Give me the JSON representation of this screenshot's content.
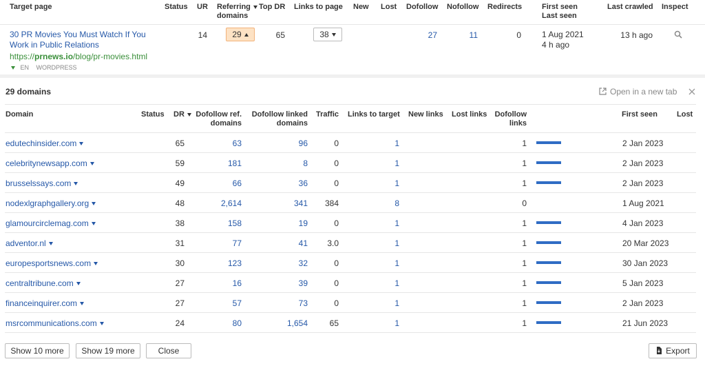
{
  "top": {
    "headers": {
      "target_page": "Target page",
      "status": "Status",
      "ur": "UR",
      "referring_l1": "Referring",
      "referring_l2": "domains",
      "top_dr": "Top DR",
      "links_to_page": "Links to page",
      "new": "New",
      "lost": "Lost",
      "dofollow": "Dofollow",
      "nofollow": "Nofollow",
      "redirects": "Redirects",
      "first_seen": "First seen",
      "last_seen": "Last seen",
      "last_crawled": "Last crawled",
      "inspect": "Inspect"
    },
    "row": {
      "title_l1": "30 PR Movies You Must Watch If You",
      "title_l2": "Work in Public Relations",
      "url_prefix": "https://",
      "url_domain": "prnews.io",
      "url_path": "/blog/pr-movies.html",
      "lang": "EN",
      "platform": "WORDPRESS",
      "ur": "14",
      "referring_domains": "29",
      "top_dr": "65",
      "links_to_page": "38",
      "dofollow": "27",
      "nofollow": "11",
      "redirects": "0",
      "first_seen": "1 Aug 2021",
      "last_seen": "4 h ago",
      "last_crawled": "13 h ago"
    }
  },
  "panel": {
    "title": "29 domains",
    "open_new_tab": "Open in a new tab",
    "headers": {
      "domain": "Domain",
      "status": "Status",
      "dr": "DR",
      "dofollow_ref_l1": "Dofollow ref.",
      "dofollow_ref_l2": "domains",
      "dofollow_linked_l1": "Dofollow linked",
      "dofollow_linked_l2": "domains",
      "traffic": "Traffic",
      "links_to_target": "Links to target",
      "new_links": "New links",
      "lost_links": "Lost links",
      "dofollow_links_l1": "Dofollow",
      "dofollow_links_l2": "links",
      "first_seen": "First seen",
      "lost": "Lost"
    },
    "rows": [
      {
        "domain": "edutechinsider.com",
        "dr": "65",
        "dofollow_ref": "63",
        "dofollow_linked": "96",
        "traffic": "0",
        "links_to_target": "1",
        "dofollow_links": "1",
        "bar": 1,
        "first_seen": "2 Jan 2023"
      },
      {
        "domain": "celebritynewsapp.com",
        "dr": "59",
        "dofollow_ref": "181",
        "dofollow_linked": "8",
        "traffic": "0",
        "links_to_target": "1",
        "dofollow_links": "1",
        "bar": 1,
        "first_seen": "2 Jan 2023"
      },
      {
        "domain": "brusselssays.com",
        "dr": "49",
        "dofollow_ref": "66",
        "dofollow_linked": "36",
        "traffic": "0",
        "links_to_target": "1",
        "dofollow_links": "1",
        "bar": 1,
        "first_seen": "2 Jan 2023"
      },
      {
        "domain": "nodexlgraphgallery.org",
        "dr": "48",
        "dofollow_ref": "2,614",
        "dofollow_linked": "341",
        "traffic": "384",
        "links_to_target": "8",
        "dofollow_links": "0",
        "bar": 0,
        "first_seen": "1 Aug 2021"
      },
      {
        "domain": "glamourcirclemag.com",
        "dr": "38",
        "dofollow_ref": "158",
        "dofollow_linked": "19",
        "traffic": "0",
        "links_to_target": "1",
        "dofollow_links": "1",
        "bar": 1,
        "first_seen": "4 Jan 2023"
      },
      {
        "domain": "adventor.nl",
        "dr": "31",
        "dofollow_ref": "77",
        "dofollow_linked": "41",
        "traffic": "3.0",
        "links_to_target": "1",
        "dofollow_links": "1",
        "bar": 1,
        "first_seen": "20 Mar 2023"
      },
      {
        "domain": "europesportsnews.com",
        "dr": "30",
        "dofollow_ref": "123",
        "dofollow_linked": "32",
        "traffic": "0",
        "links_to_target": "1",
        "dofollow_links": "1",
        "bar": 1,
        "first_seen": "30 Jan 2023"
      },
      {
        "domain": "centraltribune.com",
        "dr": "27",
        "dofollow_ref": "16",
        "dofollow_linked": "39",
        "traffic": "0",
        "links_to_target": "1",
        "dofollow_links": "1",
        "bar": 1,
        "first_seen": "5 Jan 2023"
      },
      {
        "domain": "financeinquirer.com",
        "dr": "27",
        "dofollow_ref": "57",
        "dofollow_linked": "73",
        "traffic": "0",
        "links_to_target": "1",
        "dofollow_links": "1",
        "bar": 1,
        "first_seen": "2 Jan 2023"
      },
      {
        "domain": "msrcommunications.com",
        "dr": "24",
        "dofollow_ref": "80",
        "dofollow_linked": "1,654",
        "traffic": "65",
        "links_to_target": "1",
        "dofollow_links": "1",
        "bar": 1,
        "first_seen": "21 Jun 2023"
      }
    ],
    "buttons": {
      "show_10": "Show 10 more",
      "show_19": "Show 19 more",
      "close": "Close",
      "export": "Export"
    }
  },
  "colors": {
    "link": "#2558a8",
    "url_green": "#3a8f3a",
    "highlight_bg": "#fde2c4",
    "bar": "#2f6cc4"
  }
}
